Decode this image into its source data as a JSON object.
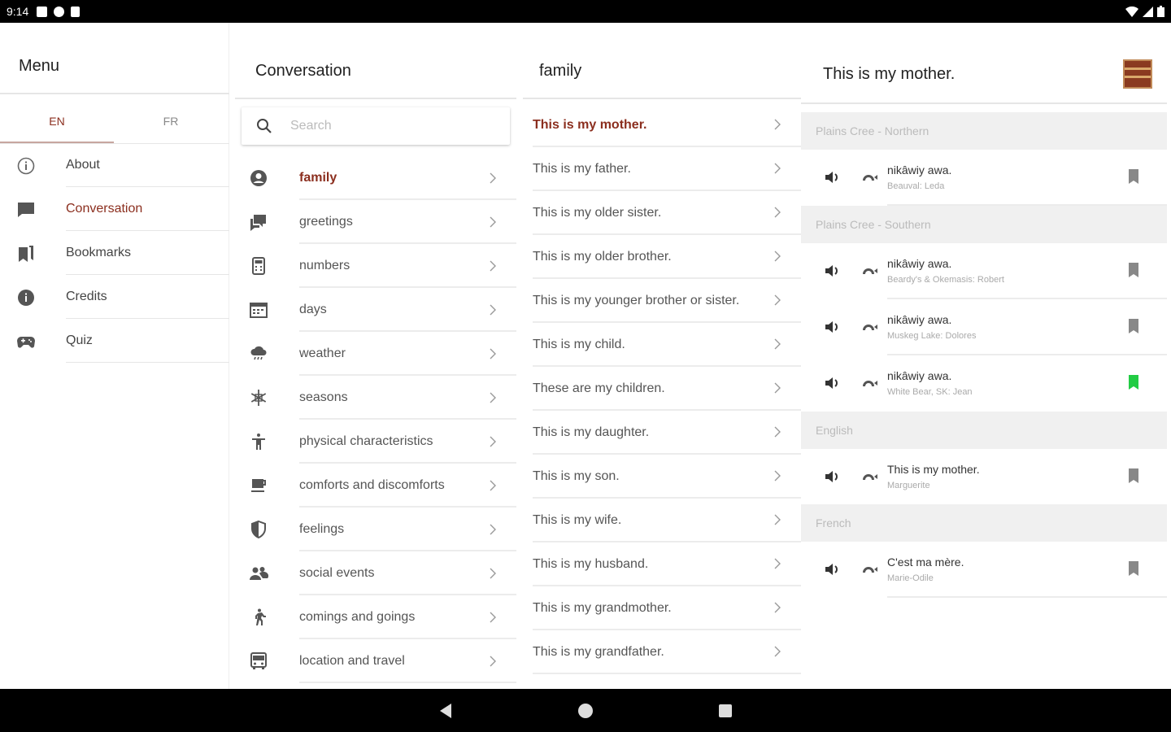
{
  "status_bar": {
    "time": "9:14"
  },
  "menu": {
    "title": "Menu",
    "lang_tabs": [
      {
        "label": "EN",
        "active": true
      },
      {
        "label": "FR",
        "active": false
      }
    ],
    "items": [
      {
        "label": "About",
        "icon": "info-outline-icon"
      },
      {
        "label": "Conversation",
        "icon": "chat-icon",
        "active": true
      },
      {
        "label": "Bookmarks",
        "icon": "bookmarks-icon"
      },
      {
        "label": "Credits",
        "icon": "info-filled-icon"
      },
      {
        "label": "Quiz",
        "icon": "gamepad-icon"
      }
    ]
  },
  "conversation": {
    "title": "Conversation",
    "search_placeholder": "Search",
    "categories": [
      {
        "label": "family",
        "icon": "person-circle-icon",
        "active": true
      },
      {
        "label": "greetings",
        "icon": "chat-bubbles-icon"
      },
      {
        "label": "numbers",
        "icon": "calculator-icon"
      },
      {
        "label": "days",
        "icon": "calendar-icon"
      },
      {
        "label": "weather",
        "icon": "cloud-rain-icon"
      },
      {
        "label": "seasons",
        "icon": "snowflake-icon"
      },
      {
        "label": "physical characteristics",
        "icon": "accessibility-icon"
      },
      {
        "label": "comforts and discomforts",
        "icon": "coffee-cup-icon"
      },
      {
        "label": "feelings",
        "icon": "shield-half-icon"
      },
      {
        "label": "social events",
        "icon": "people-icon"
      },
      {
        "label": "comings and goings",
        "icon": "walking-icon"
      },
      {
        "label": "location and travel",
        "icon": "bus-icon"
      }
    ]
  },
  "phrases": {
    "title": "family",
    "items": [
      {
        "label": "This is my mother.",
        "active": true
      },
      {
        "label": "This is my father."
      },
      {
        "label": "This is my older sister."
      },
      {
        "label": "This is my older brother."
      },
      {
        "label": "This is my younger brother or sister."
      },
      {
        "label": "This is my child."
      },
      {
        "label": "These are my children."
      },
      {
        "label": "This is my daughter."
      },
      {
        "label": "This is my son."
      },
      {
        "label": "This is my wife."
      },
      {
        "label": "This is my husband."
      },
      {
        "label": "This is my grandmother."
      },
      {
        "label": "This is my grandfather."
      }
    ]
  },
  "detail": {
    "title": "This is my mother.",
    "avatar_color": "#8a3a20",
    "sections": [
      {
        "heading": "Plains Cree - Northern",
        "recordings": [
          {
            "text": "nikâwiy awa.",
            "speaker": "Beauval: Leda",
            "bookmarked": false
          }
        ]
      },
      {
        "heading": "Plains Cree - Southern",
        "recordings": [
          {
            "text": "nikâwiy awa.",
            "speaker": "Beardy's & Okemasis: Robert",
            "bookmarked": false
          },
          {
            "text": "nikâwiy awa.",
            "speaker": "Muskeg Lake: Dolores",
            "bookmarked": false
          },
          {
            "text": "nikâwiy awa.",
            "speaker": "White Bear, SK: Jean",
            "bookmarked": true
          }
        ]
      },
      {
        "heading": "English",
        "recordings": [
          {
            "text": "This is my mother.",
            "speaker": "Marguerite",
            "bookmarked": false
          }
        ]
      },
      {
        "heading": "French",
        "recordings": [
          {
            "text": "C'est ma mère.",
            "speaker": "Marie-Odile",
            "bookmarked": false
          }
        ]
      }
    ]
  },
  "colors": {
    "accent": "#8b2e1e",
    "bookmark_on": "#22cc44",
    "bookmark_off": "#888888"
  }
}
